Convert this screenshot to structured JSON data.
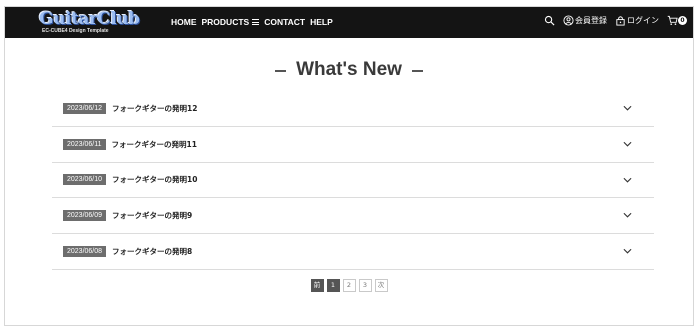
{
  "header": {
    "logo_text": "GuitarClub",
    "logo_sub": "EC-CUBE4 Design Template",
    "nav": [
      {
        "label": "HOME"
      },
      {
        "label": "PRODUCTS"
      },
      {
        "label": "CONTACT"
      },
      {
        "label": "HELP"
      }
    ],
    "search_icon": "search-icon",
    "register_label": "会員登録",
    "login_label": "ログイン",
    "cart_count": "0"
  },
  "main": {
    "title": "What's New",
    "items": [
      {
        "date": "2023/06/12",
        "title": "フォークギターの発明12"
      },
      {
        "date": "2023/06/11",
        "title": "フォークギターの発明11"
      },
      {
        "date": "2023/06/10",
        "title": "フォークギターの発明10"
      },
      {
        "date": "2023/06/09",
        "title": "フォークギターの発明9"
      },
      {
        "date": "2023/06/08",
        "title": "フォークギターの発明8"
      }
    ]
  },
  "pagination": {
    "prev": "前",
    "pages": [
      "1",
      "2",
      "3"
    ],
    "next": "次",
    "current": "1"
  },
  "colors": {
    "header_bg": "#141414",
    "date_badge_bg": "#6d6d6d",
    "active_page_bg": "#555555"
  }
}
